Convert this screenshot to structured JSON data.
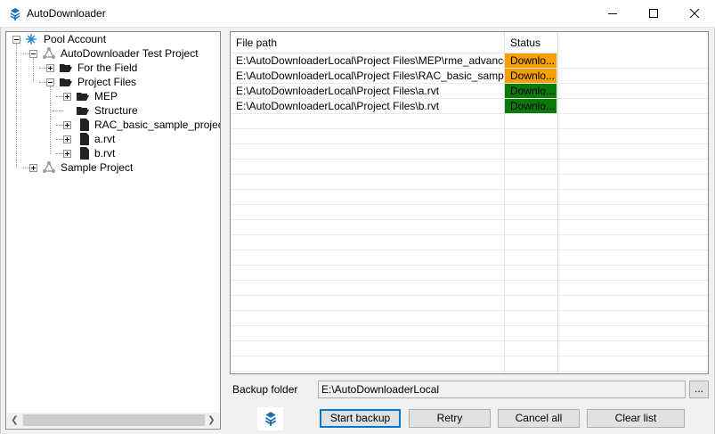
{
  "window": {
    "title": "AutoDownloader",
    "controls": {
      "minimize": "minimize-icon",
      "maximize": "maximize-icon",
      "close": "close-icon"
    }
  },
  "tree": {
    "root": {
      "label": "Pool Account",
      "icon": "network-icon"
    },
    "project1": {
      "label": "AutoDownloader Test Project",
      "icon": "project-icon"
    },
    "for_field": {
      "label": "For the Field",
      "icon": "folder-open-icon"
    },
    "project_files": {
      "label": "Project Files",
      "icon": "folder-open-icon"
    },
    "mep": {
      "label": "MEP",
      "icon": "folder-open-icon"
    },
    "structure": {
      "label": "Structure",
      "icon": "folder-open-icon"
    },
    "rac": {
      "label": "RAC_basic_sample_project.rvt",
      "icon": "file-icon"
    },
    "a": {
      "label": "a.rvt",
      "icon": "file-icon"
    },
    "b": {
      "label": "b.rvt",
      "icon": "file-icon"
    },
    "project2": {
      "label": "Sample Project",
      "icon": "project-icon"
    }
  },
  "grid": {
    "headers": {
      "file_path": "File path",
      "status": "Status"
    },
    "rows": [
      {
        "path": "E:\\AutoDownloaderLocal\\Project Files\\MEP\\rme_advanced...",
        "status": "Downlo...",
        "status_color": "#f5a000"
      },
      {
        "path": "E:\\AutoDownloaderLocal\\Project Files\\RAC_basic_sample_...",
        "status": "Downlo...",
        "status_color": "#f5a000"
      },
      {
        "path": "E:\\AutoDownloaderLocal\\Project Files\\a.rvt",
        "status": "Downlo...",
        "status_color": "#0a7a0a"
      },
      {
        "path": "E:\\AutoDownloaderLocal\\Project Files\\b.rvt",
        "status": "Downlo...",
        "status_color": "#0a7a0a"
      }
    ]
  },
  "backup": {
    "label": "Backup folder",
    "value": "E:\\AutoDownloaderLocal",
    "browse": "..."
  },
  "buttons": {
    "start": "Start backup",
    "retry": "Retry",
    "cancel": "Cancel all",
    "clear": "Clear list"
  }
}
